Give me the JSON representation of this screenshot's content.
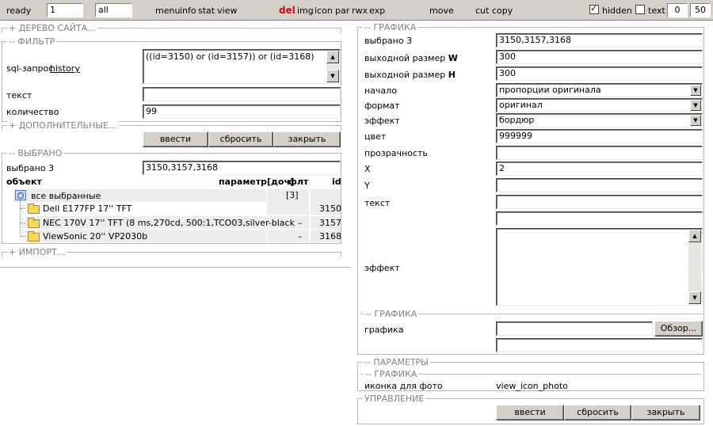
{
  "toolbar": {
    "status": "ready",
    "input1_value": "1",
    "input2_value": "all",
    "menu": [
      "menu",
      "info",
      "stat",
      "view"
    ],
    "del": "del",
    "actions": [
      "img",
      "icon",
      "par",
      "rwx",
      "exp"
    ],
    "move": "move",
    "cut": "cut",
    "copy": "copy",
    "hidden_label": "hidden",
    "hidden_checked": true,
    "text_label": "text",
    "text_checked": false,
    "range_from": "0",
    "range_to": "50"
  },
  "left": {
    "tree_section": "+ ДЕРЕВО САЙТА...",
    "filter_section": "-- ФИЛЬТР",
    "sql_label": "sql-запрос",
    "sql_link": "history",
    "sql_value": "((id=3150) or (id=3157)) or (id=3168)",
    "text_label": "текст",
    "text_value": "",
    "count_label": "количество",
    "count_value": "99",
    "extra_section": "+ ДОПОЛНИТЕЛЬНЫЕ...",
    "buttons": [
      "ввести",
      "сбросить",
      "закрыть"
    ],
    "selected_section": "-- ВЫБРАНО",
    "selected_label": "выбрано 3",
    "selected_value": "3150,3157,3168",
    "table_headers": {
      "object": "объект",
      "param": "параметр",
      "doc": "[доч]",
      "flt": "флт",
      "id": "id"
    },
    "all_selected_label": "все выбранные",
    "all_selected_count": "[3]",
    "items": [
      {
        "name": "Dell E177FP 17'' TFT",
        "flt": "",
        "id": "3150"
      },
      {
        "name": "NEC 170V 17'' TFT (8 ms,270cd, 500:1,TCO03,silver-black",
        "flt": "–",
        "id": "3157"
      },
      {
        "name": "ViewSonic 20'' VP2030b",
        "flt": "–",
        "id": "3168"
      }
    ],
    "import_section": "+ ИМПОРТ..."
  },
  "right": {
    "graphics_section": "-- ГРАФИКА",
    "fields": [
      {
        "label": "выбрано 3",
        "value": "3150,3157,3168"
      },
      {
        "label": "выходной размер",
        "label_bold": "W",
        "value": "300"
      },
      {
        "label": "выходной размер",
        "label_bold": "H",
        "value": "300"
      }
    ],
    "selects": [
      {
        "label": "начало",
        "value": "пропорции оригинала"
      },
      {
        "label": "формат",
        "value": "оригинал"
      },
      {
        "label": "эффект",
        "value": "бордюр"
      }
    ],
    "color_label": "цвет",
    "color_value": "999999",
    "transparency_label": "прозрачность",
    "x_label": "X",
    "x_value": "2",
    "y_label": "Y",
    "text_label": "текст",
    "effect_label": "эффект",
    "graphics2_section": "-- ГРАФИКА",
    "graphic_label": "графика",
    "browse_button": "Обзор...",
    "params_section": "-- ПАРАМЕТРЫ",
    "graphics3_section": "-- ГРАФИКА",
    "photo_icon_label": "иконка для фото",
    "photo_icon_value": "view_icon_photo",
    "control_section": "УПРАВЛЕНИЕ",
    "buttons": [
      "ввести",
      "сбросить",
      "закрыть"
    ]
  }
}
